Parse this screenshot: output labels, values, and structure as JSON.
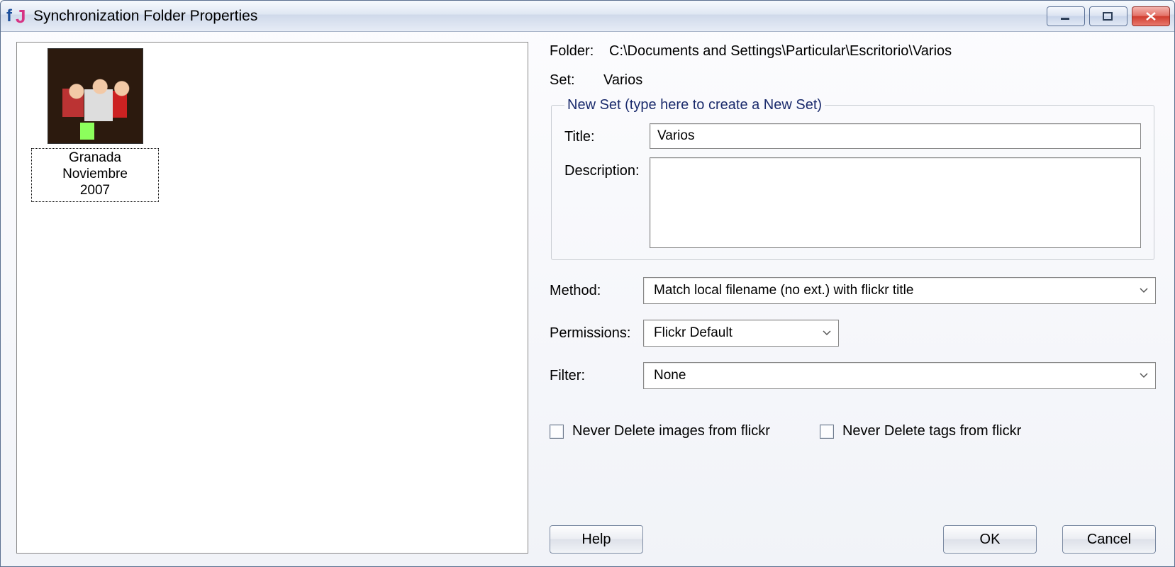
{
  "window": {
    "title": "Synchronization Folder Properties"
  },
  "thumbnail": {
    "caption": "Granada Noviembre\n2007"
  },
  "info": {
    "folder_label": "Folder:",
    "folder_value": "C:\\Documents and Settings\\Particular\\Escritorio\\Varios",
    "set_label": "Set:",
    "set_value": "Varios"
  },
  "new_set": {
    "legend": "New Set   (type here to create a New Set)",
    "title_label": "Title:",
    "title_value": "Varios",
    "description_label": "Description:",
    "description_value": ""
  },
  "settings": {
    "method_label": "Method:",
    "method_value": "Match local filename (no ext.) with flickr title",
    "permissions_label": "Permissions:",
    "permissions_value": "Flickr Default",
    "filter_label": "Filter:",
    "filter_value": "None"
  },
  "checkboxes": {
    "never_delete_images": "Never Delete images from flickr",
    "never_delete_tags": "Never Delete tags from flickr"
  },
  "buttons": {
    "help": "Help",
    "ok": "OK",
    "cancel": "Cancel"
  }
}
